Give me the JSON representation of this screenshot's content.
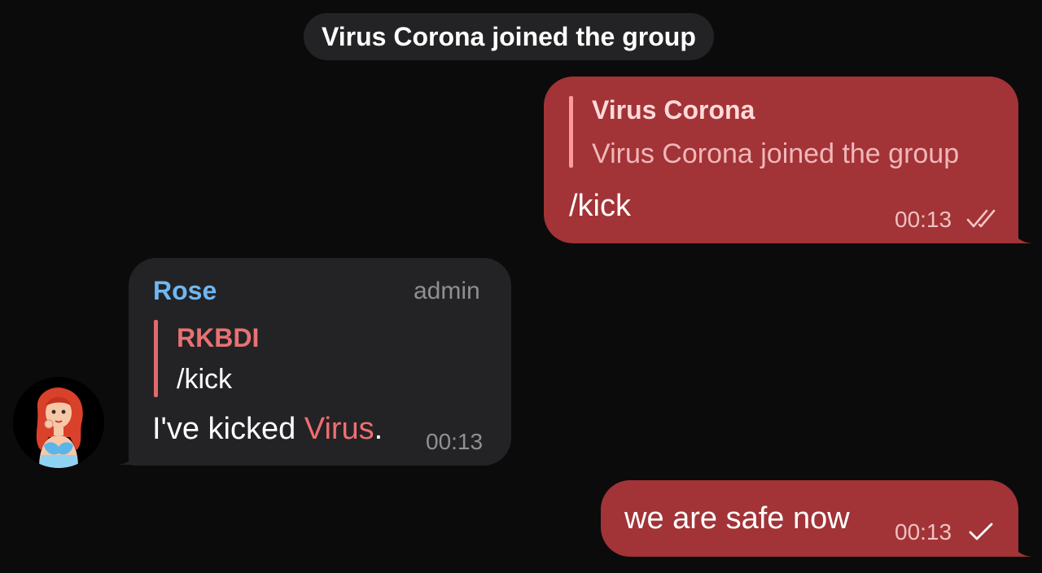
{
  "service_message": "Virus Corona joined the group",
  "messages": [
    {
      "reply": {
        "name": "Virus Corona",
        "text": "Virus Corona joined the group"
      },
      "text": "/kick",
      "time": "00:13",
      "status_icon": "double-check-icon"
    },
    {
      "sender": "Rose",
      "role": "admin",
      "reply": {
        "name": "RKBDI",
        "text": "/kick"
      },
      "text_prefix": "I've kicked ",
      "mention": "Virus",
      "text_suffix": ".",
      "time": "00:13",
      "avatar_icon": "cartoon-girl-avatar"
    },
    {
      "text": "we are safe now",
      "time": "00:13",
      "status_icon": "single-check-icon"
    }
  ],
  "colors": {
    "background": "#0b0b0c",
    "outgoing_bubble": "#a23336",
    "incoming_bubble": "#232325",
    "sender_name": "#6fb7f3",
    "mention": "#ee6e72"
  }
}
